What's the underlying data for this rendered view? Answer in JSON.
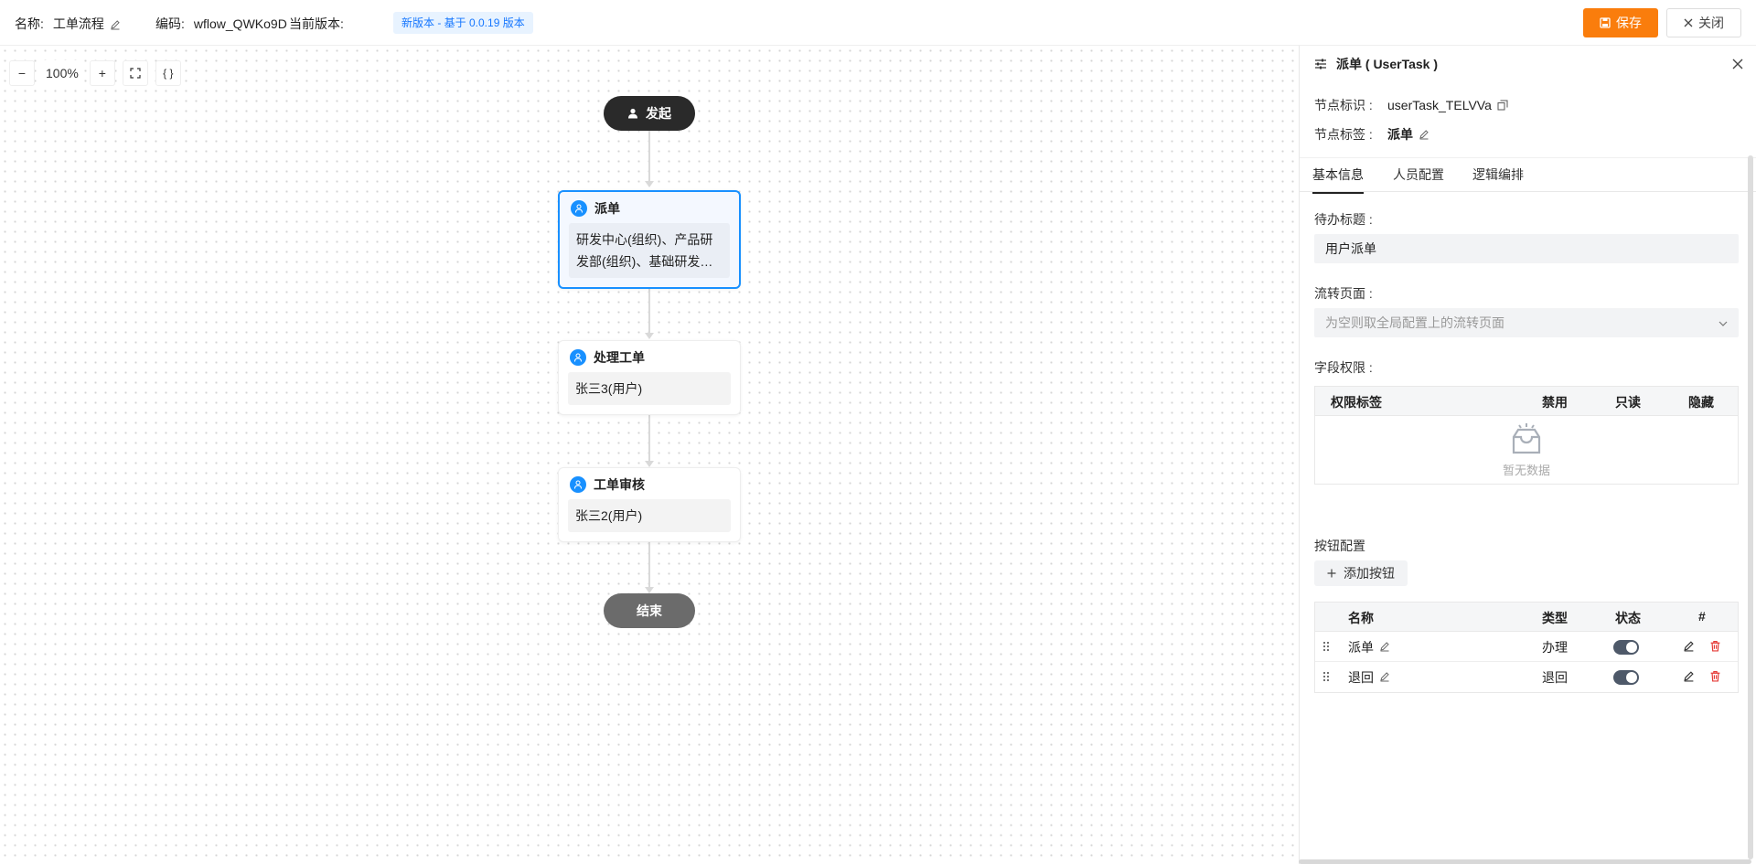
{
  "header": {
    "name_label": "名称:",
    "name_value": "工单流程",
    "code_label": "编码:",
    "code_value": "wflow_QWKo9D",
    "version_label": "当前版本:",
    "version_badge": "新版本 - 基于 0.0.19 版本",
    "save_label": "保存",
    "close_label": "关闭",
    "accent_color": "#fa7d0c"
  },
  "canvas": {
    "zoom_level": "100%",
    "zoom_out": "−",
    "zoom_in": "+",
    "code_btn": "{ }",
    "start_label": "发起",
    "end_label": "结束",
    "nodes": [
      {
        "title": "派单",
        "body": "研发中心(组织)、产品研发部(组织)、基础研发…",
        "selected": true
      },
      {
        "title": "处理工单",
        "body": "张三3(用户)",
        "selected": false
      },
      {
        "title": "工单审核",
        "body": "张三2(用户)",
        "selected": false
      }
    ]
  },
  "panel": {
    "title": "派单 ( UserTask )",
    "node_id_label": "节点标识 :",
    "node_id_value": "userTask_TELVVa",
    "node_tag_label": "节点标签 :",
    "node_tag_value": "派单",
    "tabs": [
      {
        "label": "基本信息",
        "active": true
      },
      {
        "label": "人员配置",
        "active": false
      },
      {
        "label": "逻辑编排",
        "active": false
      }
    ],
    "todo_title_label": "待办标题 :",
    "todo_title_value": "用户派单",
    "flow_page_label": "流转页面 :",
    "flow_page_placeholder": "为空则取全局配置上的流转页面",
    "field_perm_label": "字段权限 :",
    "perm_headers": {
      "tag": "权限标签",
      "disabled": "禁用",
      "readonly": "只读",
      "hidden": "隐藏"
    },
    "empty_text": "暂无数据",
    "button_config_label": "按钮配置",
    "add_button_label": "添加按钮",
    "btn_headers": {
      "name": "名称",
      "type": "类型",
      "status": "状态",
      "action": "#"
    },
    "buttons": [
      {
        "name": "派单",
        "type": "办理",
        "enabled": true
      },
      {
        "name": "退回",
        "type": "退回",
        "enabled": true
      }
    ]
  }
}
